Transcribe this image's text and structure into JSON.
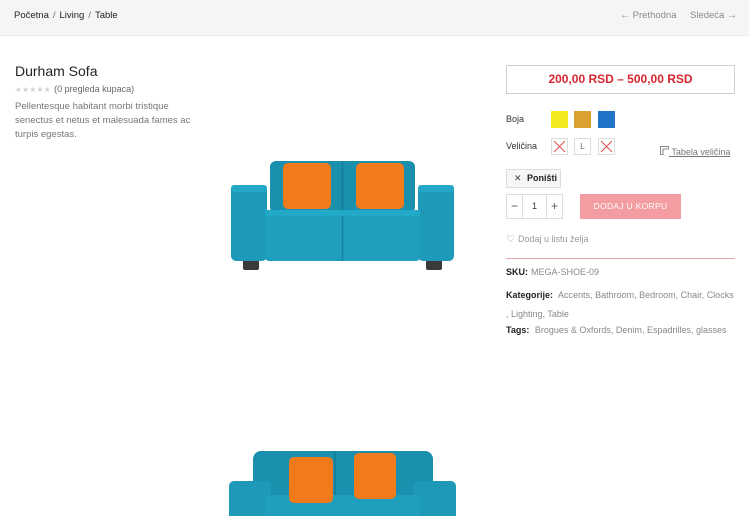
{
  "breadcrumb": {
    "home": "Početna",
    "category": "Living",
    "current": "Table",
    "separator": "/"
  },
  "nav": {
    "prev_label": "Prethodna",
    "next_label": "Sledeća",
    "prev_arrow": "←",
    "next_arrow": "→"
  },
  "product": {
    "title": "Durham Sofa",
    "stars": "★★★★★",
    "review_text": "(0 pregleda kupaca)",
    "description": "Pellentesque habitant morbi tristique senectus et netus et malesuada fames ac turpis egestas.",
    "price": "200,00 RSD – 500,00 RSD",
    "color_label": "Boja",
    "colors": [
      "#f3ea23",
      "#dba032",
      "#1f74c9"
    ],
    "size_label": "Veličina",
    "sizes": [
      "",
      "L",
      ""
    ],
    "size_table_label": "Tabela veličina",
    "reset_label": "Poništi",
    "quantity": "1",
    "minus": "−",
    "plus": "+",
    "add_to_cart": "DODAJ U KORPU",
    "wishlist": "Dodaj u listu želja",
    "sku_label": "SKU:",
    "sku_value": "MEGA-SHOE-09",
    "categories_label": "Kategorije:",
    "categories": [
      "Accents",
      "Bathroom",
      "Bedroom",
      "Chair",
      "Clocks",
      "Lighting",
      "Table"
    ],
    "tags_label": "Tags:",
    "tags": [
      "Brogues & Oxfords",
      "Denim",
      "Espadrilles",
      "glasses"
    ]
  },
  "colors": {
    "price": "#d6262f",
    "button": "#f39ca1",
    "sofa": "#1e9ab8",
    "pillow": "#f07a1c"
  },
  "icons": {
    "prev": "arrow-left-icon",
    "next": "arrow-right-icon",
    "close": "close-icon",
    "heart": "heart-icon",
    "ruler": "ruler-icon"
  }
}
